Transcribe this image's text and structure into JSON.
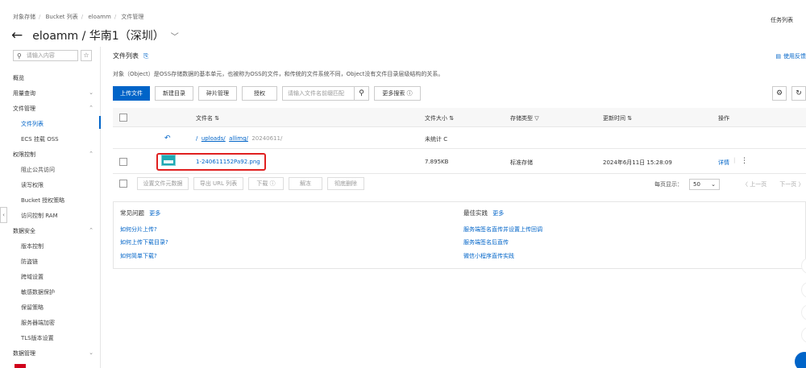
{
  "breadcrumb": [
    "对象存储",
    "Bucket 列表",
    "eloamm",
    "文件管理"
  ],
  "task_list": "任务列表",
  "page_title": "eloamm / 华南1（深圳）",
  "sidebar": {
    "search_placeholder": "请输入内容",
    "items": [
      {
        "label": "概览",
        "type": "top",
        "chevron": ""
      },
      {
        "label": "用量查询",
        "type": "top",
        "chevron": "⌄"
      },
      {
        "label": "文件管理",
        "type": "top",
        "chevron": "⌃"
      },
      {
        "label": "文件列表",
        "type": "sub",
        "chevron": ""
      },
      {
        "label": "ECS 挂载 OSS",
        "type": "sub",
        "chevron": ""
      },
      {
        "label": "权限控制",
        "type": "top",
        "chevron": "⌃"
      },
      {
        "label": "阻止公共访问",
        "type": "sub",
        "chevron": ""
      },
      {
        "label": "读写权限",
        "type": "sub",
        "chevron": ""
      },
      {
        "label": "Bucket 授权策略",
        "type": "sub",
        "chevron": ""
      },
      {
        "label": "访问控制 RAM",
        "type": "sub",
        "chevron": ""
      },
      {
        "label": "数据安全",
        "type": "top",
        "chevron": "⌃"
      },
      {
        "label": "版本控制",
        "type": "sub",
        "chevron": ""
      },
      {
        "label": "防盗链",
        "type": "sub",
        "chevron": ""
      },
      {
        "label": "跨域设置",
        "type": "sub",
        "chevron": ""
      },
      {
        "label": "敏感数据保护",
        "type": "sub",
        "chevron": ""
      },
      {
        "label": "保留策略",
        "type": "sub",
        "chevron": ""
      },
      {
        "label": "服务器端加密",
        "type": "sub",
        "chevron": ""
      },
      {
        "label": "TLS版本设置",
        "type": "sub",
        "chevron": ""
      },
      {
        "label": "数据管理",
        "type": "top",
        "chevron": "⌄"
      }
    ]
  },
  "section": {
    "title": "文件列表",
    "help": "使用反馈",
    "description": "对象（Object）是OSS存储数据的基本单元，也被称为OSS的文件，和传统的文件系统不同，Object没有文件目录层级结构的关系。"
  },
  "toolbar": {
    "upload": "上传文件",
    "new_dir": "新建目录",
    "fragments": "碎片管理",
    "authorize": "授权",
    "search_placeholder": "请输入文件名前缀匹配",
    "more_search": "更多搜索 ⓘ"
  },
  "table": {
    "headers": {
      "name": "文件名 ⇅",
      "size": "文件大小 ⇅",
      "storage": "存储类型 ▽",
      "updated": "更新时间 ⇅",
      "actions": "操作"
    },
    "path": {
      "root": "/",
      "seg1": "uploads/",
      "seg2": "allimg/",
      "seg3": "20240611/",
      "size": "未统计 C"
    },
    "rows": [
      {
        "name": "1-240611152Pa92.png",
        "size": "7.895KB",
        "storage": "标准存储",
        "updated": "2024年6月11日 15:28:09",
        "detail": "详情",
        "more": "⋮"
      }
    ]
  },
  "bulk": {
    "set_meta": "设置文件元数据",
    "export_url": "导出 URL 列表",
    "download": "下载 ⓘ",
    "unfreeze": "解冻",
    "delete": "彻底删除"
  },
  "pager": {
    "per_page_label": "每页显示：",
    "per_page": "50",
    "prev": "〈 上一页",
    "next": "下一页 〉"
  },
  "faq": {
    "left_title": "常见问题",
    "right_title": "最佳实践",
    "more": "更多",
    "left_links": [
      "如何分片上传?",
      "如何上传下载目录?",
      "如何简单下载?"
    ],
    "right_links": [
      "服务端签名直传并设置上传回调",
      "服务端签名后直传",
      "微信小程序直传实践"
    ]
  }
}
